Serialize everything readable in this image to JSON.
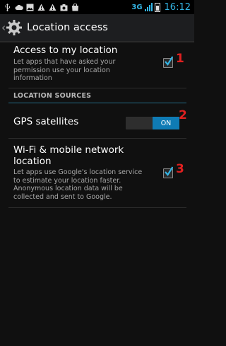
{
  "statusbar": {
    "network": "3G",
    "time": "16:12",
    "icons": [
      "usb-icon",
      "cloud-icon",
      "image-icon",
      "warning-icon",
      "warning-icon",
      "camera-icon",
      "bag-icon"
    ]
  },
  "actionbar": {
    "title": "Location access"
  },
  "items": [
    {
      "title": "Access to my location",
      "summary_lines": [
        "Let apps that have asked your",
        "permission use your location",
        "information"
      ],
      "checked": true,
      "annotation": "1"
    }
  ],
  "section": {
    "header": "LOCATION SOURCES"
  },
  "gps": {
    "title": "GPS satellites",
    "toggle_state": "ON",
    "annotation": "2"
  },
  "wifi": {
    "title_lines": [
      "Wi-Fi & mobile network",
      "location"
    ],
    "summary_lines": [
      "Let apps use Google's location service",
      "to estimate your location faster.",
      "Anonymous location data will be",
      "collected and sent to Google."
    ],
    "checked": true,
    "annotation": "3"
  },
  "colors": {
    "accent": "#33b5e5",
    "toggle_on": "#0f7bb5",
    "annotation": "#e02020"
  }
}
